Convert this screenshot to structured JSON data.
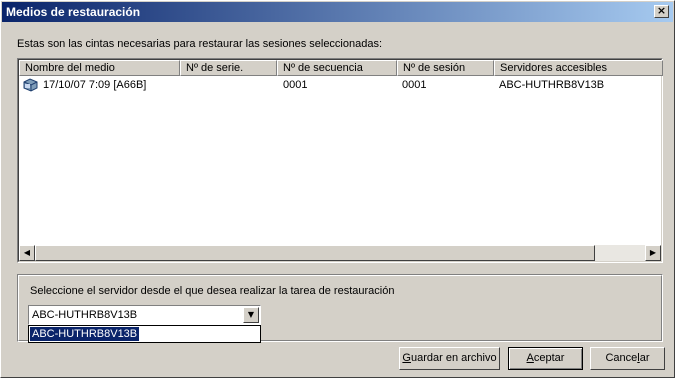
{
  "window": {
    "title": "Medios de restauración",
    "close_glyph": "×"
  },
  "intro_text": "Estas son las cintas necesarias para restaurar las sesiones seleccionadas:",
  "table": {
    "columns": [
      "Nombre del medio",
      "Nº de serie.",
      "Nº de secuencia",
      "Nº de sesión",
      "Servidores accesibles"
    ],
    "rows": [
      {
        "icon": "tape-icon",
        "media_name": "17/10/07 7:09 [A66B]",
        "serial": "",
        "sequence": "0001",
        "session": "0001",
        "servers": "ABC-HUTHRB8V13B"
      }
    ]
  },
  "scrollbar": {
    "left_arrow": "◀",
    "right_arrow": "▶"
  },
  "server_select": {
    "label": "Seleccione el servidor desde el que desea realizar la tarea de restauración",
    "value": "ABC-HUTHRB8V13B",
    "arrow": "▼",
    "options": [
      "ABC-HUTHRB8V13B"
    ]
  },
  "buttons": {
    "save_prefix": "",
    "save_accel": "G",
    "save_rest": "uardar en archivo",
    "ok_accel": "A",
    "ok_rest": "ceptar",
    "cancel_prefix": "Cance",
    "cancel_accel": "l",
    "cancel_rest": "ar"
  },
  "colors": {
    "titlebar_start": "#0a246a",
    "titlebar_end": "#a6caf0",
    "selection": "#0a246a",
    "face": "#d4d0c8"
  }
}
